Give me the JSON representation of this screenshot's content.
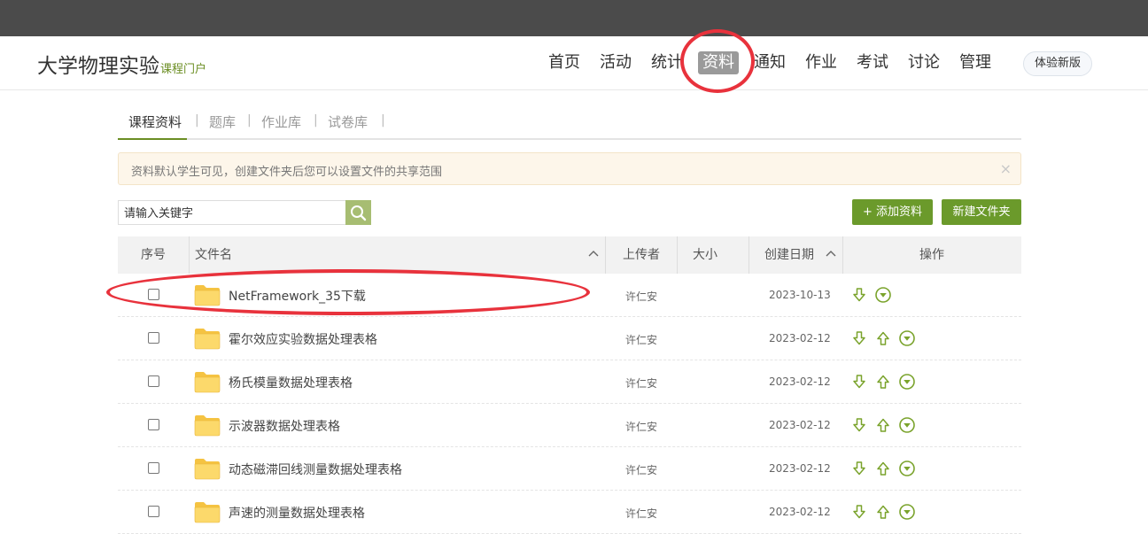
{
  "header": {
    "brand_title": "大学物理实验",
    "brand_sub": "课程门户",
    "nav": [
      "首页",
      "活动",
      "统计",
      "资料",
      "通知",
      "作业",
      "考试",
      "讨论",
      "管理"
    ],
    "active_nav": "资料",
    "try_new": "体验新版"
  },
  "subtabs": [
    "课程资料",
    "题库",
    "作业库",
    "试卷库"
  ],
  "notice": {
    "text": "资料默认学生可见，创建文件夹后您可以设置文件的共享范围",
    "close": "×"
  },
  "search": {
    "placeholder": "请输入关键字"
  },
  "actions": {
    "add": "+ 添加资料",
    "new_folder": "新建文件夹"
  },
  "table": {
    "headers": {
      "index": "序号",
      "name": "文件名",
      "uploader": "上传者",
      "size": "大小",
      "date": "创建日期",
      "ops": "操作"
    },
    "rows": [
      {
        "name": "NetFramework_35下载",
        "uploader": "许仁安",
        "size": "",
        "date": "2023-10-13",
        "ops": [
          "download",
          "more"
        ]
      },
      {
        "name": "霍尔效应实验数据处理表格",
        "uploader": "许仁安",
        "size": "",
        "date": "2023-02-12",
        "ops": [
          "download",
          "upload",
          "more"
        ]
      },
      {
        "name": "杨氏模量数据处理表格",
        "uploader": "许仁安",
        "size": "",
        "date": "2023-02-12",
        "ops": [
          "download",
          "upload",
          "more"
        ]
      },
      {
        "name": "示波器数据处理表格",
        "uploader": "许仁安",
        "size": "",
        "date": "2023-02-12",
        "ops": [
          "download",
          "upload",
          "more"
        ]
      },
      {
        "name": "动态磁滞回线测量数据处理表格",
        "uploader": "许仁安",
        "size": "",
        "date": "2023-02-12",
        "ops": [
          "download",
          "upload",
          "more"
        ]
      },
      {
        "name": "声速的测量数据处理表格",
        "uploader": "许仁安",
        "size": "",
        "date": "2023-02-12",
        "ops": [
          "download",
          "upload",
          "more"
        ]
      }
    ]
  },
  "colors": {
    "accent_green": "#6b9a2b",
    "annotation_red": "#e8323c",
    "topbar": "#4b4b4b"
  },
  "icons": {
    "search": "search-icon",
    "folder": "folder-icon",
    "download": "arrow-down-icon",
    "upload": "arrow-up-icon",
    "more": "chevron-circle-icon"
  }
}
